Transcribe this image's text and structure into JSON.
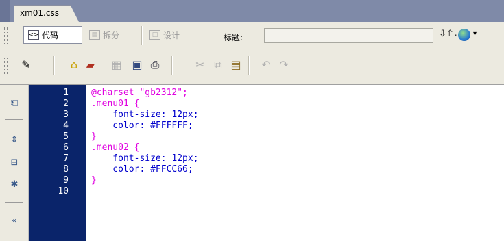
{
  "document_tab": {
    "label": "xm01.css"
  },
  "view_toolbar": {
    "code_label": "代码",
    "split_label": "拆分",
    "design_label": "设计",
    "title_label": "标题:",
    "title_value": ""
  },
  "editor": {
    "lines": [
      {
        "number": "1",
        "text": "@charset \"gb2312\";",
        "color": "#e000e0"
      },
      {
        "number": "2",
        "text": ".menu01 {",
        "color": "#e000e0"
      },
      {
        "number": "3",
        "text": "    font-size: 12px;",
        "color": "#0000cc"
      },
      {
        "number": "4",
        "text": "    color: #FFFFFF;",
        "color": "#0000cc"
      },
      {
        "number": "5",
        "text": "}",
        "color": "#e000e0"
      },
      {
        "number": "6",
        "text": ".menu02 {",
        "color": "#e000e0"
      },
      {
        "number": "7",
        "text": "    font-size: 12px;",
        "color": "#0000cc"
      },
      {
        "number": "8",
        "text": "    color: #FFCC66;",
        "color": "#0000cc"
      },
      {
        "number": "9",
        "text": "}",
        "color": "#e000e0"
      },
      {
        "number": "10",
        "text": "",
        "color": "#0000cc"
      }
    ]
  }
}
